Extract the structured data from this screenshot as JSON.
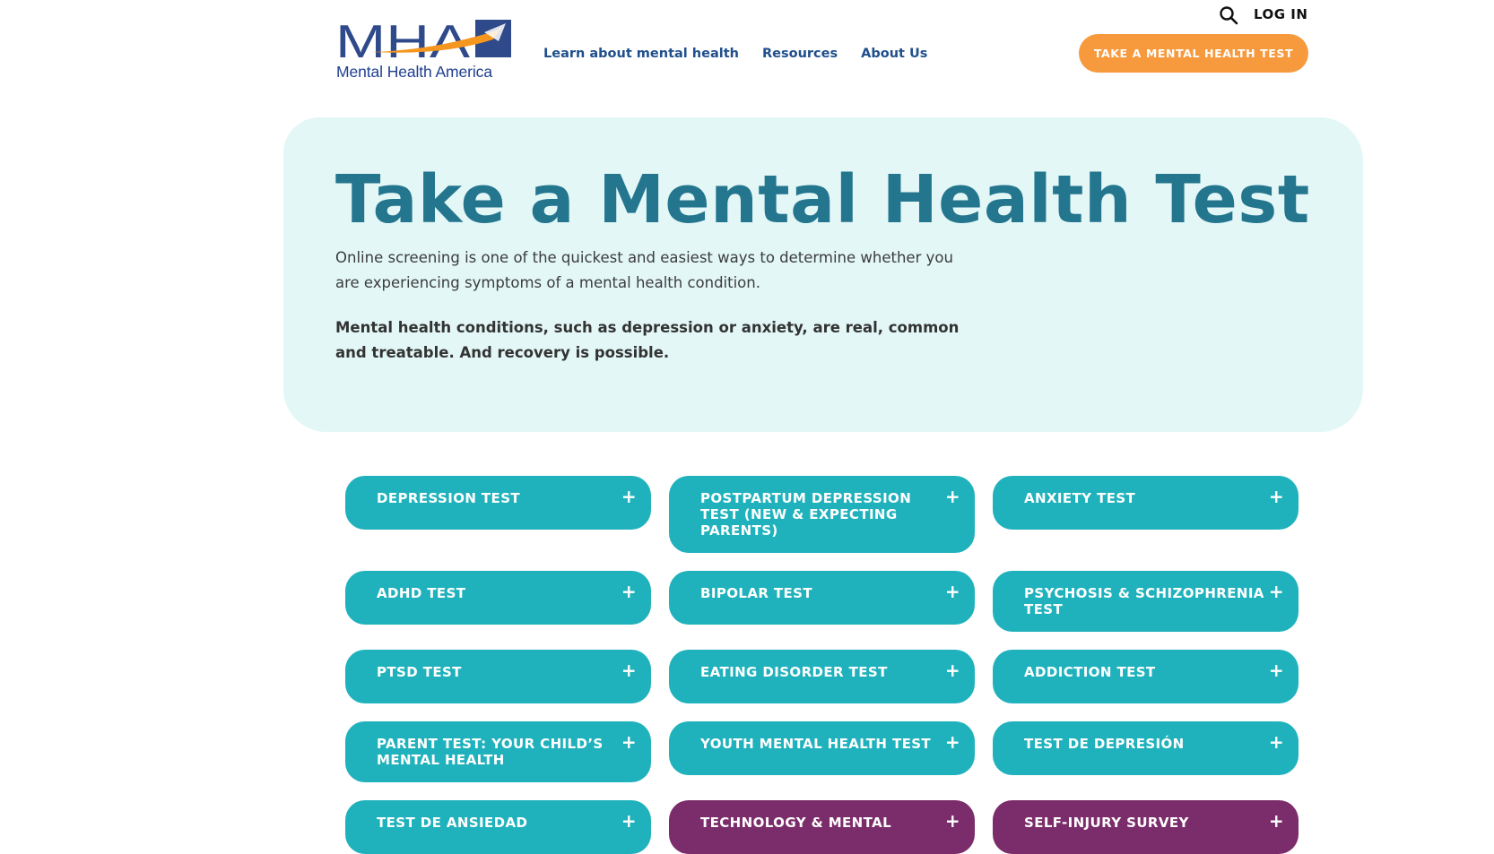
{
  "header": {
    "logo_text": "Mental Health America",
    "logo_letters": "MHA",
    "nav": [
      "Learn about mental health",
      "Resources",
      "About Us"
    ],
    "login_label": "LOG IN",
    "cta_label": "TAKE A MENTAL HEALTH TEST"
  },
  "hero": {
    "title": "Take a Mental Health Test",
    "intro": "Online screening is one of the quickest and easiest ways to determine whether you are experiencing symptoms of a mental health condition.",
    "bold": "Mental health conditions, such as depression or anxiety, are real, common and treatable. And recovery is possible."
  },
  "tests": [
    {
      "label": "DEPRESSION TEST",
      "color": "#20b2bc"
    },
    {
      "label": "POSTPARTUM DEPRESSION TEST (NEW & EXPECTING PARENTS)",
      "color": "#20b2bc"
    },
    {
      "label": "ANXIETY TEST",
      "color": "#20b2bc"
    },
    {
      "label": "ADHD TEST",
      "color": "#20b2bc"
    },
    {
      "label": "BIPOLAR TEST",
      "color": "#20b2bc"
    },
    {
      "label": "PSYCHOSIS & SCHIZOPHRENIA TEST",
      "color": "#20b2bc"
    },
    {
      "label": "PTSD TEST",
      "color": "#20b2bc"
    },
    {
      "label": "EATING DISORDER TEST",
      "color": "#20b2bc"
    },
    {
      "label": "ADDICTION TEST",
      "color": "#20b2bc"
    },
    {
      "label": "PARENT TEST: YOUR CHILD’S MENTAL HEALTH",
      "color": "#20b2bc"
    },
    {
      "label": "YOUTH MENTAL HEALTH TEST",
      "color": "#20b2bc"
    },
    {
      "label": "TEST DE DEPRESIÓN",
      "color": "#20b2bc"
    },
    {
      "label": "TEST DE ANSIEDAD",
      "color": "#20b2bc"
    },
    {
      "label": "TECHNOLOGY & MENTAL",
      "color": "#7b2c6a"
    },
    {
      "label": "SELF-INJURY SURVEY",
      "color": "#7b2c6a"
    }
  ],
  "colors": {
    "brand_blue": "#24768e",
    "nav_blue": "#1f4f8c",
    "teal": "#20b2bc",
    "purple": "#7b2c6a",
    "orange": "#f79a3e",
    "hero_bg": "#e3f7f7"
  },
  "icons": {
    "search": "search-icon",
    "plus": "plus-icon"
  }
}
